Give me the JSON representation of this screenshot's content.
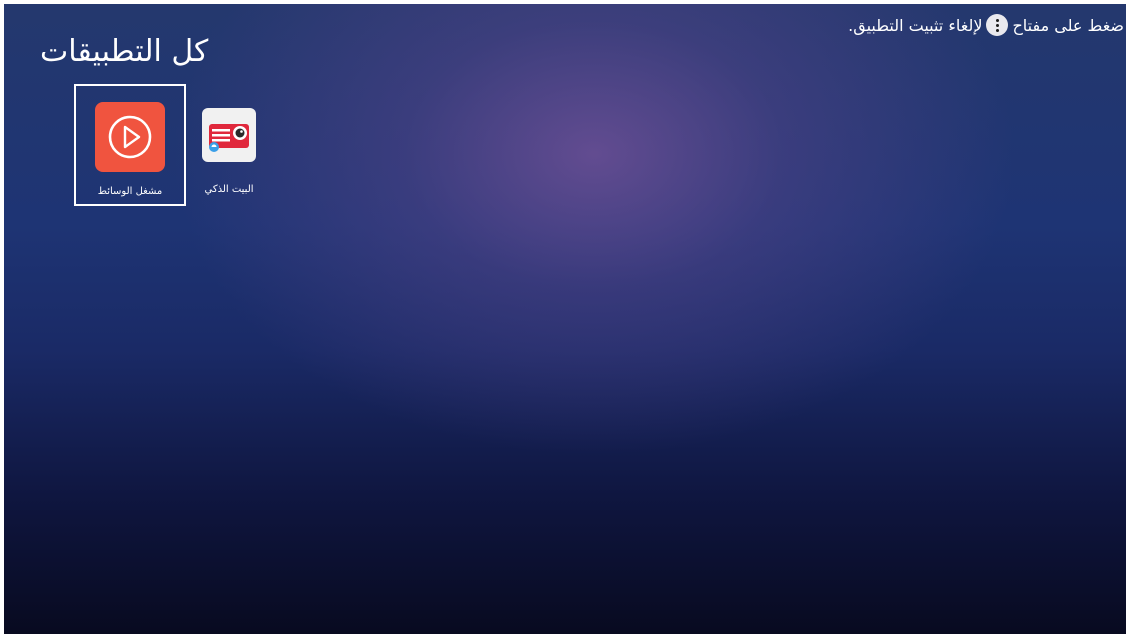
{
  "screen": {
    "title": "كل التطبيقات",
    "hint": {
      "before": "ضغط على مفتاح",
      "key_icon": "vertical-dots-menu-icon",
      "after": "لإلغاء تثبيت التطبيق."
    }
  },
  "apps": [
    {
      "label": "مشغل الوسائط",
      "icon": "media-player-play-icon",
      "focused": true,
      "color": "#f0543f"
    },
    {
      "label": "البيت الذكي",
      "icon": "smart-home-projector-icon",
      "focused": false,
      "color": "#e0283c"
    }
  ]
}
